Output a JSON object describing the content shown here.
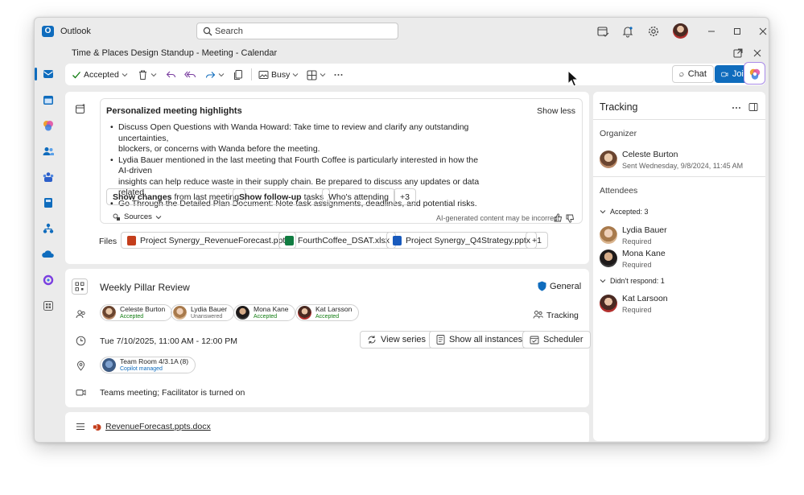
{
  "app": {
    "name": "Outlook",
    "logo_letter": "O"
  },
  "search": {
    "placeholder": "Search"
  },
  "window": {
    "subtitle": "Time & Places Design Standup - Meeting - Calendar"
  },
  "toolbar": {
    "accepted_label": "Accepted",
    "busy_label": "Busy",
    "chat_label": "Chat",
    "join_label": "Join"
  },
  "highlights": {
    "title": "Personalized meeting highlights",
    "show_less": "Show less",
    "bullets": [
      {
        "line1": "Discuss Open Questions with Wanda Howard: Take time to review and clarify any outstanding uncertainties,",
        "line2": "blockers, or concerns with Wanda before the meeting."
      },
      {
        "line1": "Lydia Bauer mentioned in the last meeting that Fourth Coffee is particularly interested in how the AI-driven",
        "line2": "insights can help reduce waste in their supply chain. Be prepared to discuss any updates or data related."
      },
      {
        "line1": "Go Through the Detailed Plan Document: Note task assignments, deadlines, and potential risks.",
        "line2": ""
      }
    ],
    "chips": [
      {
        "bold": "Show changes",
        "rest": "from last meeting"
      },
      {
        "bold": "Show follow-up",
        "rest": "tasks"
      },
      {
        "bold": "",
        "rest": "Who's attending"
      },
      {
        "bold": "",
        "rest": "+3"
      }
    ],
    "sources_label": "Sources",
    "disclaimer": "AI-generated content may be incorrect"
  },
  "files": {
    "label": "Files",
    "items": [
      {
        "name": "Project Synergy_RevenueForecast.pptx",
        "color": "#c43e1c"
      },
      {
        "name": "FourthCoffee_DSAT.xlsx",
        "color": "#107c41"
      },
      {
        "name": "Project Synergy_Q4Strategy.pptx",
        "color": "#185abd"
      }
    ],
    "more": "+1"
  },
  "meeting": {
    "title": "Weekly Pillar Review",
    "label": "General",
    "attendees": [
      {
        "name": "Celeste Burton",
        "status": "Accepted"
      },
      {
        "name": "Lydia Bauer",
        "status": "Unanswered"
      },
      {
        "name": "Mona Kane",
        "status": "Accepted"
      },
      {
        "name": "Kat Larsson",
        "status": "Accepted"
      }
    ],
    "tracking_label": "Tracking",
    "datetime": "Tue 7/10/2025, 11:00 AM - 12:00 PM",
    "view_series": "View series",
    "show_all_instances": "Show all instances",
    "scheduler": "Scheduler",
    "room_name": "Team Room 4/3.1A (8)",
    "room_sub": "Copilot managed",
    "teams_text": "Teams meeting; Facilitator is turned on",
    "attachment": "RevenueForecast.ppts.docx"
  },
  "tracking": {
    "title": "Tracking",
    "organizer_label": "Organizer",
    "organizer": {
      "name": "Celeste Burton",
      "sub": "Sent Wednesday, 9/8/2024, 11:45 AM"
    },
    "attendees_label": "Attendees",
    "accepted_group": "Accepted: 3",
    "accepted": [
      {
        "name": "Lydia Bauer",
        "sub": "Required"
      },
      {
        "name": "Mona Kane",
        "sub": "Required"
      }
    ],
    "no_response_group": "Didn't respond: 1",
    "no_response": [
      {
        "name": "Kat Larsoon",
        "sub": "Required"
      }
    ]
  },
  "colors": {
    "accent": "#0f6cbd",
    "accepted": "#107c10",
    "copilot_border": "#a98be8"
  }
}
